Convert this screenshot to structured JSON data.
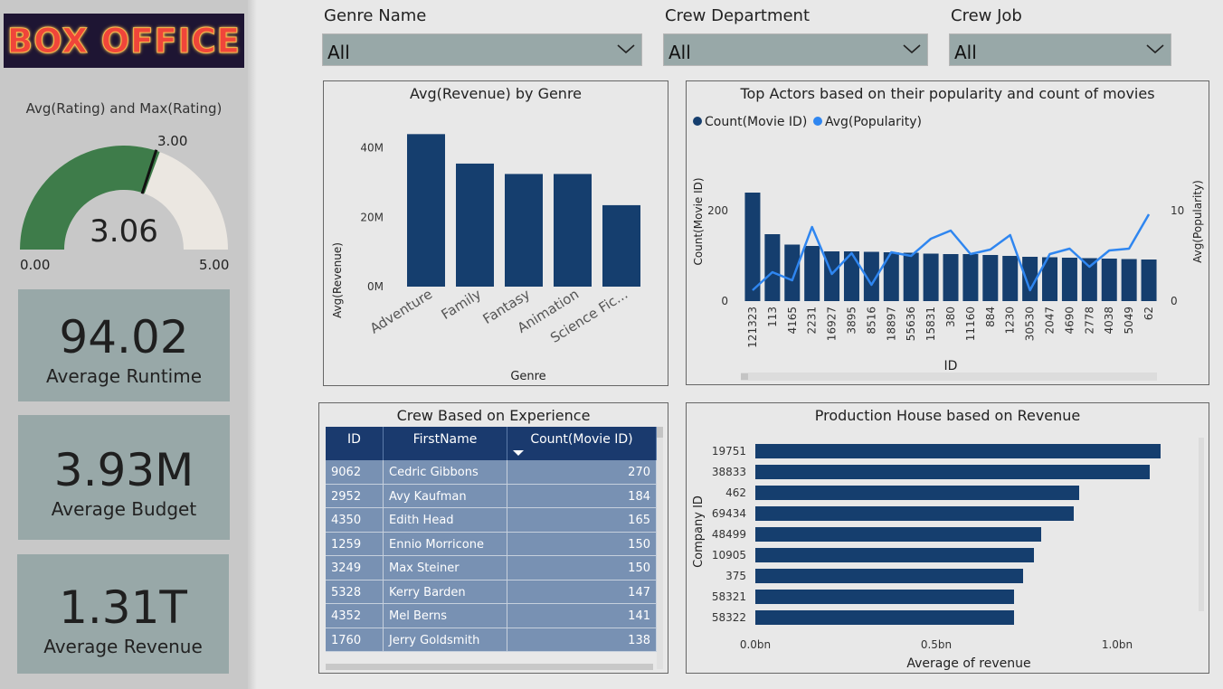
{
  "logo": {
    "text": "BOX OFFICE"
  },
  "gauge": {
    "title": "Avg(Rating) and Max(Rating)",
    "value": 3.06,
    "value_label": "3.06",
    "target": 3.0,
    "target_label": "3.00",
    "min": 0,
    "max": 5,
    "min_label": "0.00",
    "max_label": "5.00",
    "colors": {
      "fill": "#3e7c4a",
      "track": "#ebe7e1",
      "needle": "#111111"
    }
  },
  "kpis": [
    {
      "value": "94.02",
      "label": "Average Runtime"
    },
    {
      "value": "3.93M",
      "label": "Average Budget"
    },
    {
      "value": "1.31T",
      "label": "Average Revenue"
    }
  ],
  "slicers": [
    {
      "title": "Genre Name",
      "value": "All",
      "icon": "chevron-down-icon"
    },
    {
      "title": "Crew Department",
      "value": "All",
      "icon": "chevron-down-icon"
    },
    {
      "title": "Crew Job",
      "value": "All",
      "icon": "chevron-down-icon"
    }
  ],
  "colors": {
    "bar": "#153e6e",
    "line": "#2f86f0",
    "table_header": "#1a3a6e",
    "table_row": "#7891b3",
    "kpi_bg": "#98a8a8"
  },
  "chart_data": [
    {
      "type": "bar",
      "title": "Avg(Revenue) by Genre",
      "xlabel": "Genre",
      "ylabel": "Avg(Revenue)",
      "categories": [
        "Adventure",
        "Family",
        "Fantasy",
        "Animation",
        "Science Fic..."
      ],
      "values": [
        44000000,
        35500000,
        32500000,
        32500000,
        23500000
      ],
      "yticks": [
        0,
        20000000,
        40000000
      ],
      "ytick_labels": [
        "0M",
        "20M",
        "40M"
      ],
      "ylim": [
        0,
        48000000
      ]
    },
    {
      "type": "bar",
      "title": "Top Actors based on their popularity and count of movies",
      "xlabel": "ID",
      "ylabel": "Count(Movie ID)",
      "y2label": "Avg(Popularity)",
      "legend": [
        "Count(Movie ID)",
        "Avg(Popularity)"
      ],
      "legend_position": "top-left",
      "categories": [
        "121323",
        "113",
        "4165",
        "2231",
        "16927",
        "3895",
        "8516",
        "18897",
        "55636",
        "15831",
        "380",
        "11160",
        "884",
        "1230",
        "30530",
        "2047",
        "4690",
        "2778",
        "4038",
        "5049",
        "62"
      ],
      "series": [
        {
          "name": "Count(Movie ID)",
          "type": "bar",
          "axis": "left",
          "values": [
            240,
            148,
            125,
            122,
            110,
            110,
            109,
            108,
            107,
            105,
            104,
            104,
            102,
            100,
            98,
            97,
            96,
            95,
            94,
            93,
            92
          ]
        },
        {
          "name": "Avg(Popularity)",
          "type": "line",
          "axis": "right",
          "values": [
            1.2,
            3.2,
            2.3,
            8.2,
            3.0,
            5.3,
            1.8,
            5.4,
            5.0,
            6.9,
            7.8,
            5.2,
            5.7,
            7.3,
            1.2,
            5.2,
            5.8,
            3.8,
            5.6,
            5.8,
            9.6
          ]
        },
        {
          "name": "",
          "type": "none",
          "values": []
        }
      ],
      "yticks": [
        0,
        200
      ],
      "ylim": [
        0,
        300
      ],
      "y2ticks": [
        0,
        10
      ],
      "y2lim": [
        0,
        15
      ]
    },
    {
      "type": "bar",
      "orientation": "horizontal",
      "title": "Production House based on Revenue",
      "xlabel": "Average of revenue",
      "ylabel": "Company ID",
      "categories": [
        "19751",
        "38833",
        "462",
        "69434",
        "48499",
        "10905",
        "375",
        "58321",
        "58322"
      ],
      "values": [
        1120000000,
        1090000000,
        895000000,
        880000000,
        790000000,
        770000000,
        740000000,
        715000000,
        715000000
      ],
      "xticks": [
        0,
        500000000,
        1000000000
      ],
      "xtick_labels": [
        "0.0bn",
        "0.5bn",
        "1.0bn"
      ],
      "xlim": [
        0,
        1250000000
      ]
    }
  ],
  "crew_table": {
    "title": "Crew Based on Experience",
    "columns": [
      "ID",
      "FirstName",
      "Count(Movie ID)"
    ],
    "sort_column": "Count(Movie ID)",
    "rows": [
      [
        "9062",
        "Cedric Gibbons",
        "270"
      ],
      [
        "2952",
        "Avy Kaufman",
        "184"
      ],
      [
        "4350",
        "Edith Head",
        "165"
      ],
      [
        "1259",
        "Ennio Morricone",
        "150"
      ],
      [
        "3249",
        "Max Steiner",
        "150"
      ],
      [
        "5328",
        "Kerry Barden",
        "147"
      ],
      [
        "4352",
        "Mel Berns",
        "141"
      ],
      [
        "1760",
        "Jerry Goldsmith",
        "138"
      ]
    ]
  }
}
